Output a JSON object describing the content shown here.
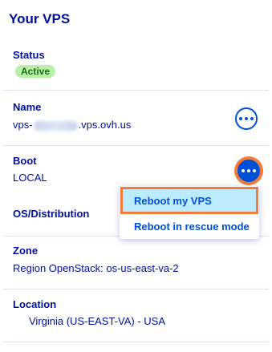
{
  "panel": {
    "title": "Your VPS"
  },
  "status": {
    "label": "Status",
    "badge": "Active"
  },
  "name": {
    "label": "Name",
    "prefix": "vps-",
    "suffix": ".vps.ovh.us"
  },
  "boot": {
    "label": "Boot",
    "value": "LOCAL"
  },
  "os": {
    "label": "OS/Distribution"
  },
  "zone": {
    "label": "Zone",
    "value": "Region OpenStack: os-us-east-va-2"
  },
  "location": {
    "label": "Location",
    "value": "Virginia (US-EAST-VA) - USA"
  },
  "boot_menu": {
    "items": [
      "Reboot my VPS",
      "Reboot in rescue mode"
    ]
  },
  "colors": {
    "text": "#000e9c",
    "accent": "#0050d7",
    "badge_bg": "#b8f0a8",
    "highlight": "#f27a3a",
    "menu_hover": "#bdebff"
  },
  "icons": {
    "more_actions": "ellipsis-icon"
  }
}
